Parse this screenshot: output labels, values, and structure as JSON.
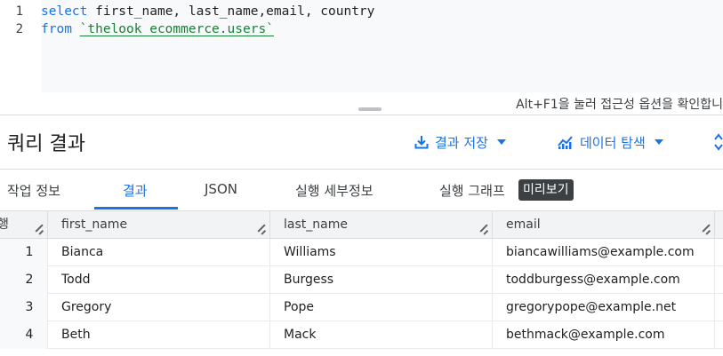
{
  "editor": {
    "line_numbers": [
      "1",
      "2"
    ],
    "line1": {
      "keyword": "select",
      "rest": " first_name, last_name,email, country"
    },
    "line2": {
      "keyword": "from",
      "space": " ",
      "table": "`thelook_ecommerce.users`"
    },
    "a11y_hint": "Alt+F1을 눌러 접근성 옵션을 확인합니"
  },
  "results": {
    "title": "쿼리 결과",
    "save_label": "결과 저장",
    "explore_label": "데이터 탐색"
  },
  "tabs": {
    "job_info": "작업 정보",
    "results": "결과",
    "json": "JSON",
    "execution_details": "실행 세부정보",
    "execution_graph": "실행 그래프",
    "preview_badge": "미리보기"
  },
  "table": {
    "headers": [
      "행",
      "first_name",
      "last_name",
      "email"
    ],
    "rows": [
      {
        "num": "1",
        "first_name": "Bianca",
        "last_name": "Williams",
        "email": "biancawilliams@example.com"
      },
      {
        "num": "2",
        "first_name": "Todd",
        "last_name": "Burgess",
        "email": "toddburgess@example.com"
      },
      {
        "num": "3",
        "first_name": "Gregory",
        "last_name": "Pope",
        "email": "gregorypope@example.net"
      },
      {
        "num": "4",
        "first_name": "Beth",
        "last_name": "Mack",
        "email": "bethmack@example.com"
      }
    ]
  },
  "colors": {
    "accent": "#1a73e8",
    "keyword": "#1a73e8",
    "table_ref": "#188038",
    "badge_bg": "#3c4043"
  }
}
